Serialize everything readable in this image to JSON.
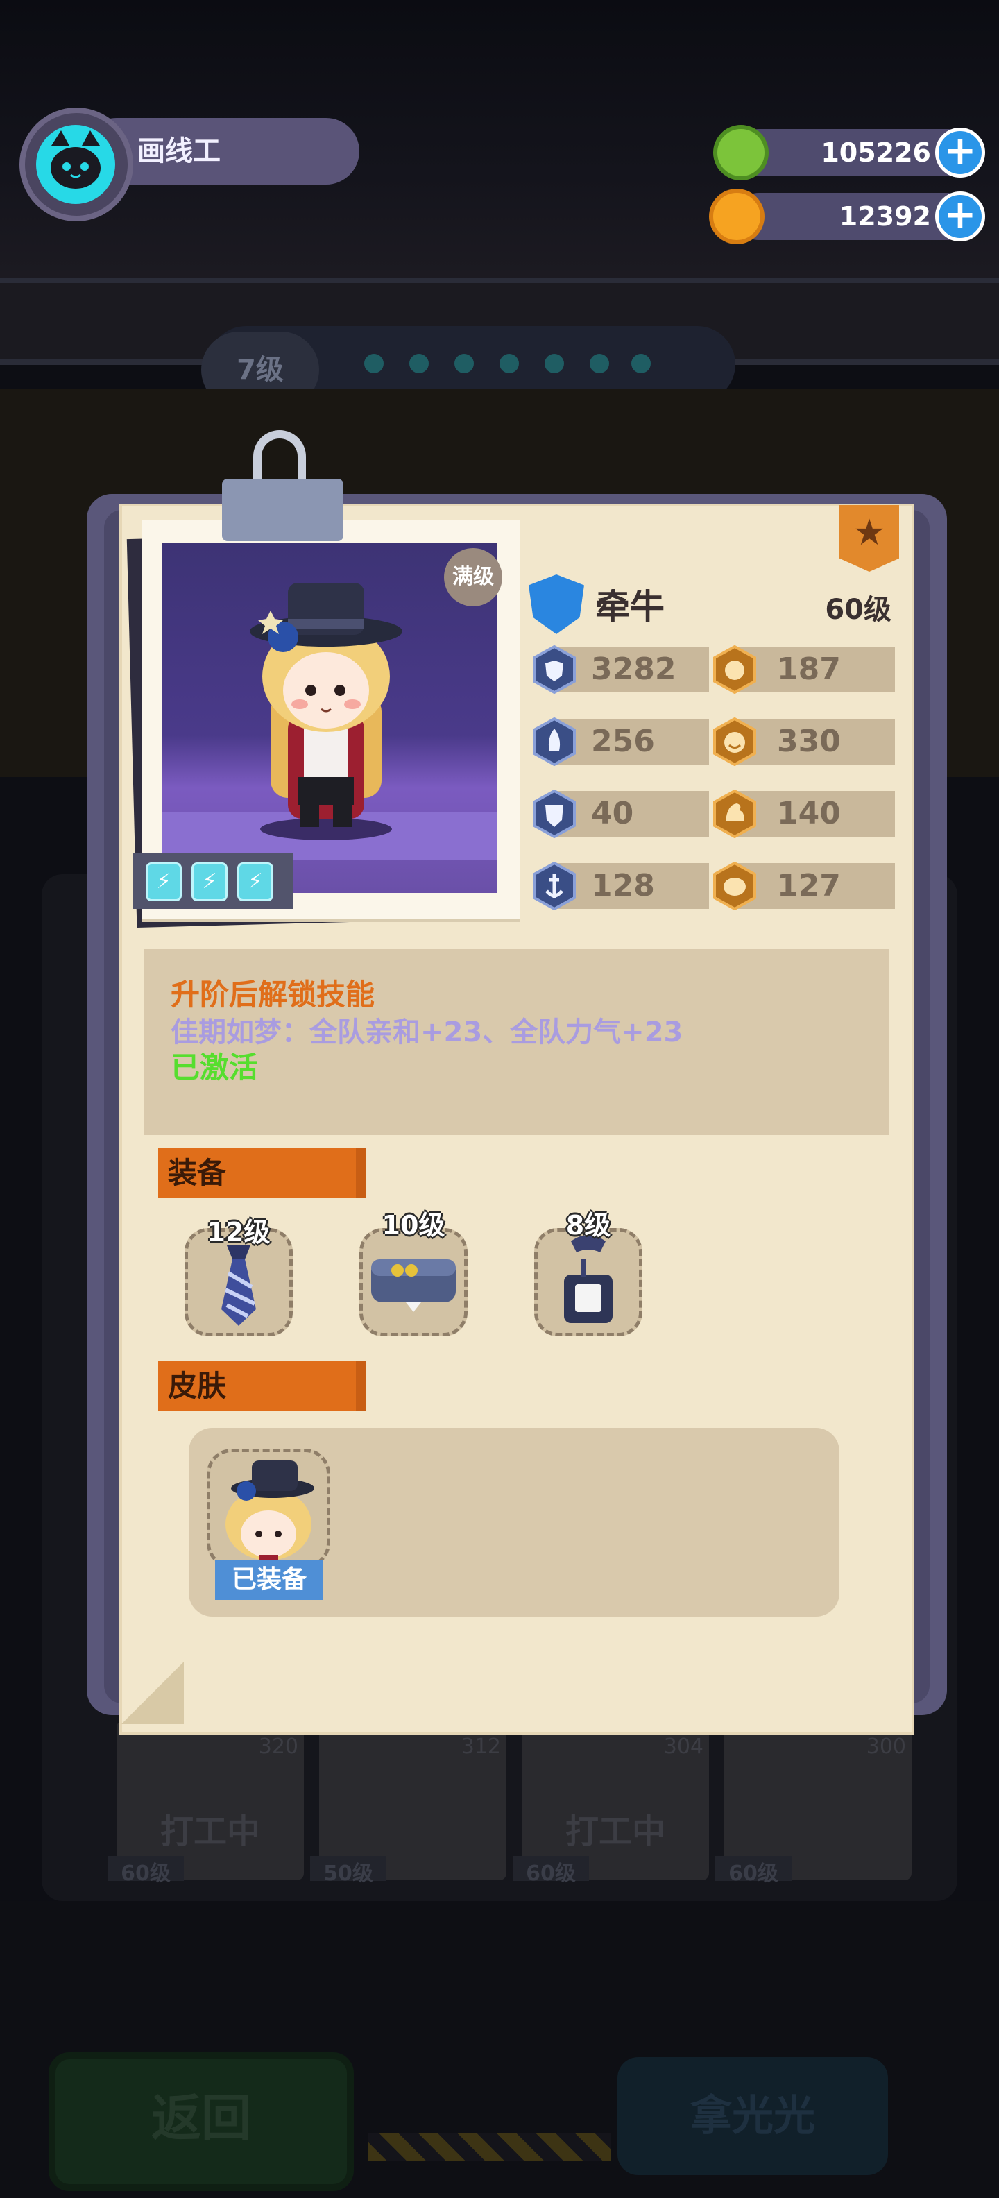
{
  "header": {
    "player_name": "画线工",
    "currencies": [
      {
        "icon": "green-gem-coin-icon",
        "value": "105226"
      },
      {
        "icon": "orange-planet-coin-icon",
        "value": "12392"
      }
    ]
  },
  "background": {
    "level_label": "7级",
    "roster": [
      {
        "status": "打工中",
        "level": "60级",
        "number": "320"
      },
      {
        "status": "",
        "level": "50级",
        "number": "312"
      },
      {
        "status": "打工中",
        "level": "60级",
        "number": "304"
      },
      {
        "status": "",
        "level": "60级",
        "number": "300"
      }
    ],
    "return_label": "返回",
    "other_button_label": "拿光光"
  },
  "character": {
    "max_badge": "满级",
    "name": "牵牛",
    "level": "60级",
    "stats": [
      {
        "icon": "heart-shield-icon",
        "value": "3282"
      },
      {
        "icon": "sparkle-fist-icon",
        "value": "187"
      },
      {
        "icon": "rocket-icon",
        "value": "256"
      },
      {
        "icon": "smile-face-icon",
        "value": "330"
      },
      {
        "icon": "shield-icon",
        "value": "40"
      },
      {
        "icon": "muscle-arm-icon",
        "value": "140"
      },
      {
        "icon": "anchor-icon",
        "value": "128"
      },
      {
        "icon": "brain-icon",
        "value": "127"
      }
    ]
  },
  "skill": {
    "title": "升阶后解锁技能",
    "description": "佳期如梦：全队亲和+23、全队力气+23",
    "status": "已激活"
  },
  "equipment": {
    "section_label": "装备",
    "items": [
      {
        "icon": "necktie-icon",
        "level": "12级"
      },
      {
        "icon": "pencil-case-icon",
        "level": "10级"
      },
      {
        "icon": "id-badge-icon",
        "level": "8级"
      }
    ]
  },
  "skin": {
    "section_label": "皮肤",
    "equipped_label": "已装备"
  },
  "colors": {
    "paper": "#f2e7cc",
    "accent_orange": "#e06e1a",
    "skill_purple": "#a99ce0",
    "active_green": "#56de2e",
    "stat_bar": "#c9b89b"
  }
}
